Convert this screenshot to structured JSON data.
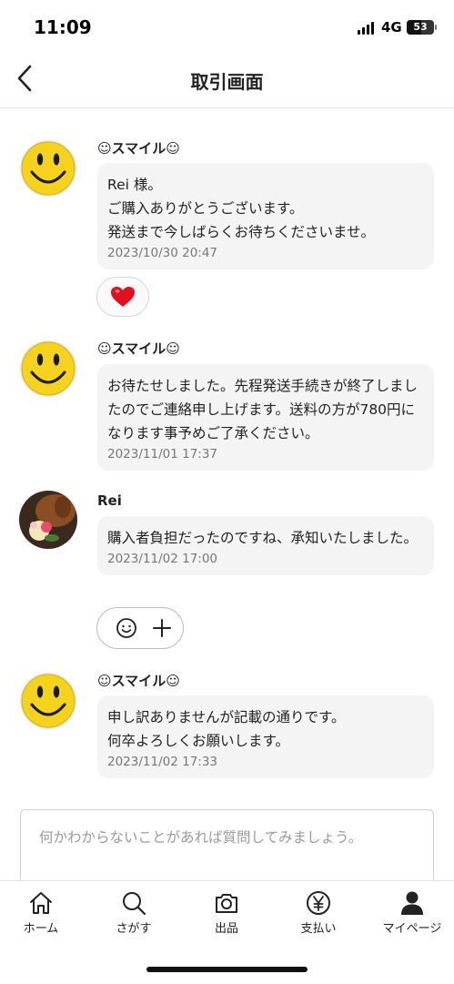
{
  "status_bar": {
    "time": "11:09",
    "network": "4G",
    "battery": "53"
  },
  "header": {
    "title": "取引画面"
  },
  "messages": [
    {
      "sender": "☺スマイル☺",
      "lines": "Rei 様。\nご購入ありがとうございます。\n発送まで今しばらくお待ちくださいませ。",
      "timestamp": "2023/10/30 20:47",
      "reaction": "heart"
    },
    {
      "sender": "☺スマイル☺",
      "lines": "お待たせしました。先程発送手続きが終了しましたのでご連絡申し上げます。送料の方が780円になります事予めご了承ください。",
      "timestamp": "2023/11/01 17:37"
    },
    {
      "sender": "Rei",
      "lines": "購入者負担だったのですね、承知いたしました。",
      "timestamp": "2023/11/02 17:00",
      "reaction": "add"
    },
    {
      "sender": "☺スマイル☺",
      "lines": "申し訳ありませんが記載の通りです。\n何卒よろしくお願いします。",
      "timestamp": "2023/11/02 17:33"
    }
  ],
  "composer": {
    "placeholder": "何かわからないことがあれば質問してみましょう。"
  },
  "tabs": [
    {
      "label": "ホーム",
      "icon": "home-icon"
    },
    {
      "label": "さがす",
      "icon": "search-icon"
    },
    {
      "label": "出品",
      "icon": "camera-icon"
    },
    {
      "label": "支払い",
      "icon": "yen-icon"
    },
    {
      "label": "マイページ",
      "icon": "person-icon"
    }
  ],
  "colors": {
    "bubble": "#f4f4f4",
    "smiley": "#f5d21c",
    "heart": "#e0101e",
    "text": "#222222",
    "timestamp": "#777777"
  }
}
